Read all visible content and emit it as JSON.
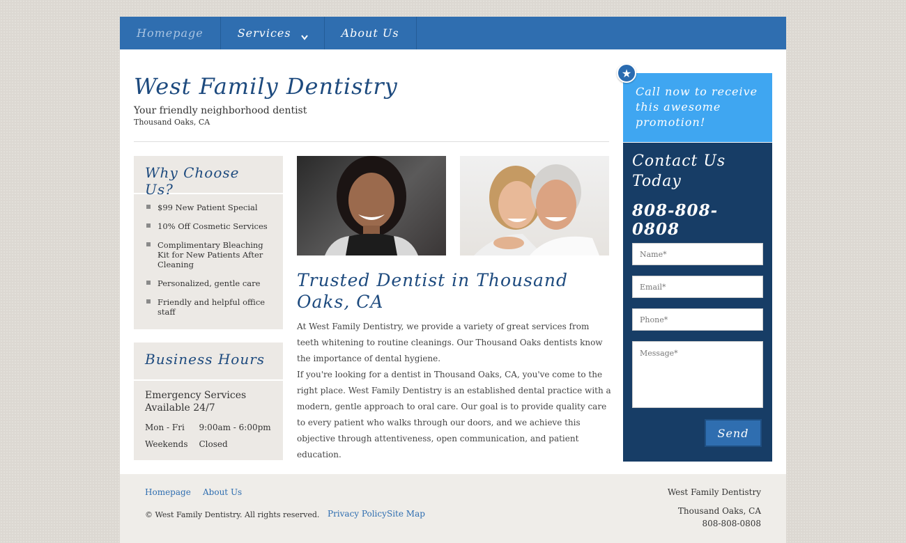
{
  "nav": {
    "items": [
      {
        "label": "Homepage"
      },
      {
        "label": "Services"
      },
      {
        "label": "About Us"
      }
    ]
  },
  "header": {
    "title": "West Family Dentistry",
    "tagline": "Your friendly neighborhood dentist",
    "location": "Thousand Oaks, CA"
  },
  "why": {
    "title": "Why Choose Us?",
    "items": [
      "$99 New Patient Special",
      "10% Off Cosmetic Services",
      "Complimentary Bleaching Kit for New Patients After Cleaning",
      "Personalized, gentle care",
      "Friendly and helpful office staff"
    ]
  },
  "hours": {
    "title": "Business Hours",
    "emergency": "Emergency Services Available 24/7",
    "rows": [
      {
        "day": "Mon - Fri",
        "time": "9:00am - 6:00pm"
      },
      {
        "day": "Weekends",
        "time": "Closed"
      }
    ]
  },
  "main": {
    "title": "Trusted Dentist in Thousand Oaks, CA",
    "paragraph1": "At West Family Dentistry, we provide a variety of great services from teeth whitening to routine cleanings. Our Thousand Oaks dentists know the importance of dental hygiene.",
    "paragraph2": "If you're looking for a dentist in Thousand Oaks, CA, you've come to the right place. West Family Dentistry is an established dental practice with a modern, gentle approach to oral care. Our goal is to provide quality care to every patient who walks through our doors, and we achieve this objective through attentiveness, open communication, and patient education."
  },
  "promo": {
    "text": "Call now to receive this awesome promotion!"
  },
  "contact": {
    "title": "Contact Us Today",
    "phone": "808-808-0808",
    "name_placeholder": "Name*",
    "email_placeholder": "Email*",
    "phone_placeholder": "Phone*",
    "message_placeholder": "Message*",
    "send_label": "Send"
  },
  "footer": {
    "links": [
      "Homepage",
      "About Us"
    ],
    "copyright": "© West Family Dentistry. All rights reserved.",
    "policy": "Privacy Policy",
    "sitemap": "Site Map",
    "business": "West Family Dentistry",
    "city": "Thousand Oaks, CA",
    "phone": "808-808-0808"
  },
  "colors": {
    "nav": "#2f6eb0",
    "title": "#1d4a7e",
    "promo": "#3fa6f1",
    "contact_bg": "#173d66"
  }
}
